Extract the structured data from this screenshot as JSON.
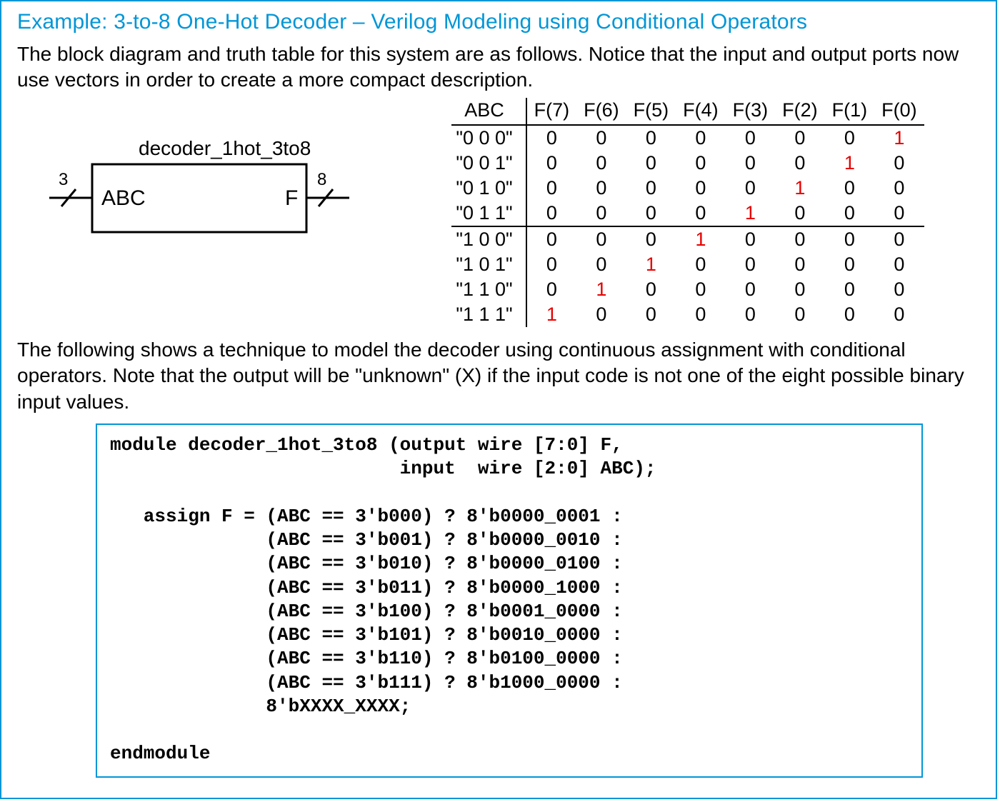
{
  "title": "Example: 3-to-8 One-Hot Decoder – Verilog Modeling using Conditional Operators",
  "para1": "The block diagram and truth table for this system are as follows.  Notice that the input and output ports now use vectors in order to create a more compact description.",
  "para2": "The following shows a technique to model the decoder using continuous assignment with conditional operators.  Note that the output will be \"unknown\" (X) if the input code is not one of the eight possible binary input values.",
  "block": {
    "module_label": "decoder_1hot_3to8",
    "in_label": "ABC",
    "in_width": "3",
    "out_label": "F",
    "out_width": "8"
  },
  "table": {
    "header_in": "ABC",
    "header_out": [
      "F(7)",
      "F(6)",
      "F(5)",
      "F(4)",
      "F(3)",
      "F(2)",
      "F(1)",
      "F(0)"
    ],
    "rows": [
      {
        "abc": "\"0 0 0\"",
        "out": [
          "0",
          "0",
          "0",
          "0",
          "0",
          "0",
          "0",
          "1"
        ],
        "hot": 7
      },
      {
        "abc": "\"0 0 1\"",
        "out": [
          "0",
          "0",
          "0",
          "0",
          "0",
          "0",
          "1",
          "0"
        ],
        "hot": 6
      },
      {
        "abc": "\"0 1 0\"",
        "out": [
          "0",
          "0",
          "0",
          "0",
          "0",
          "1",
          "0",
          "0"
        ],
        "hot": 5
      },
      {
        "abc": "\"0 1 1\"",
        "out": [
          "0",
          "0",
          "0",
          "0",
          "1",
          "0",
          "0",
          "0"
        ],
        "hot": 4
      },
      {
        "abc": "\"1 0 0\"",
        "out": [
          "0",
          "0",
          "0",
          "1",
          "0",
          "0",
          "0",
          "0"
        ],
        "hot": 3
      },
      {
        "abc": "\"1 0 1\"",
        "out": [
          "0",
          "0",
          "1",
          "0",
          "0",
          "0",
          "0",
          "0"
        ],
        "hot": 2
      },
      {
        "abc": "\"1 1 0\"",
        "out": [
          "0",
          "1",
          "0",
          "0",
          "0",
          "0",
          "0",
          "0"
        ],
        "hot": 1
      },
      {
        "abc": "\"1 1 1\"",
        "out": [
          "1",
          "0",
          "0",
          "0",
          "0",
          "0",
          "0",
          "0"
        ],
        "hot": 0
      }
    ],
    "split_after": 4
  },
  "code": "module decoder_1hot_3to8 (output wire [7:0] F,\n                          input  wire [2:0] ABC);\n\n   assign F = (ABC == 3'b000) ? 8'b0000_0001 :\n              (ABC == 3'b001) ? 8'b0000_0010 :\n              (ABC == 3'b010) ? 8'b0000_0100 :\n              (ABC == 3'b011) ? 8'b0000_1000 :\n              (ABC == 3'b100) ? 8'b0001_0000 :\n              (ABC == 3'b101) ? 8'b0010_0000 :\n              (ABC == 3'b110) ? 8'b0100_0000 :\n              (ABC == 3'b111) ? 8'b1000_0000 :\n              8'bXXXX_XXXX;\n\nendmodule"
}
